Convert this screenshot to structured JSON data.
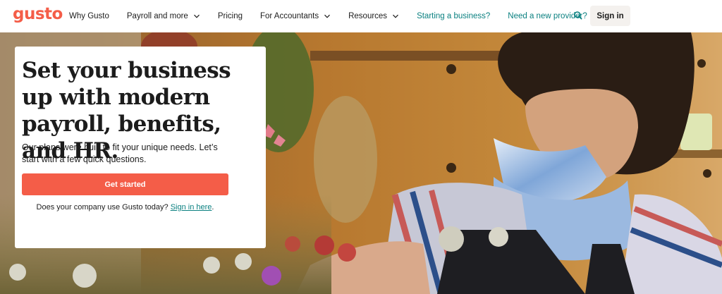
{
  "brand": {
    "logo_text": "gusto",
    "accent": "#f45d48",
    "teal": "#0a8080"
  },
  "nav": {
    "items": [
      {
        "label": "Why Gusto",
        "dropdown": false,
        "teal": false
      },
      {
        "label": "Payroll and more",
        "dropdown": true,
        "teal": false
      },
      {
        "label": "Pricing",
        "dropdown": false,
        "teal": false
      },
      {
        "label": "For Accountants",
        "dropdown": true,
        "teal": false
      },
      {
        "label": "Resources",
        "dropdown": true,
        "teal": false
      },
      {
        "label": "Starting a business?",
        "dropdown": false,
        "teal": true
      },
      {
        "label": "Need a new provider?",
        "dropdown": false,
        "teal": true
      }
    ],
    "search_icon": "search-icon",
    "signin_label": "Sign in"
  },
  "hero": {
    "headline": "Set your business up with modern payroll, benefits, and HR.",
    "subtext": "Our plans were built to fit your unique needs. Let’s start with a few quick questions.",
    "cta_label": "Get started",
    "existing_prefix": "Does your company use Gusto today?",
    "existing_link": "Sign in here",
    "existing_suffix": "."
  }
}
